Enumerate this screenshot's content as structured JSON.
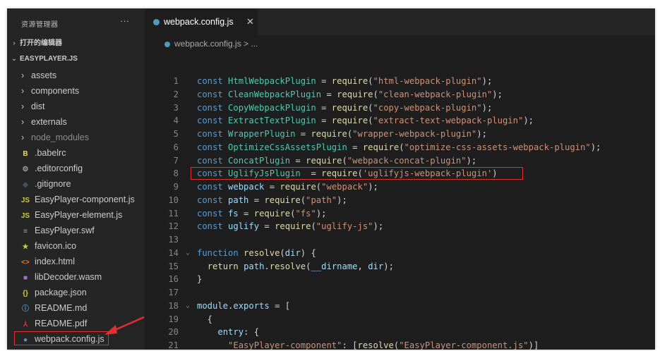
{
  "sidebar": {
    "explorer_title": "资源管理器",
    "more": "···",
    "open_editors": "打开的编辑器",
    "project": "EASYPLAYER.JS",
    "items": [
      {
        "label": "assets",
        "type": "folder",
        "icon": "chevron-right"
      },
      {
        "label": "components",
        "type": "folder",
        "icon": "chevron-right"
      },
      {
        "label": "dist",
        "type": "folder",
        "icon": "chevron-right"
      },
      {
        "label": "externals",
        "type": "folder",
        "icon": "chevron-right"
      },
      {
        "label": "node_modules",
        "type": "folder",
        "icon": "chevron-right"
      },
      {
        "label": ".babelrc",
        "type": "file",
        "icon": "babel-icon",
        "glyph": "B",
        "color": "#f5da55"
      },
      {
        "label": ".editorconfig",
        "type": "file",
        "icon": "gear-icon",
        "glyph": "⚙",
        "color": "#a0a0a0"
      },
      {
        "label": ".gitignore",
        "type": "file",
        "icon": "git-icon",
        "glyph": "◆",
        "color": "#41535b"
      },
      {
        "label": "EasyPlayer-component.js",
        "type": "file",
        "icon": "js-icon",
        "glyph": "JS",
        "color": "#cbcb41"
      },
      {
        "label": "EasyPlayer-element.js",
        "type": "file",
        "icon": "js-icon",
        "glyph": "JS",
        "color": "#cbcb41"
      },
      {
        "label": "EasyPlayer.swf",
        "type": "file",
        "icon": "file-icon",
        "glyph": "≡",
        "color": "#a0a0a0"
      },
      {
        "label": "favicon.ico",
        "type": "file",
        "icon": "star-icon",
        "glyph": "★",
        "color": "#cbcb41"
      },
      {
        "label": "index.html",
        "type": "file",
        "icon": "html-icon",
        "glyph": "<>",
        "color": "#e37933"
      },
      {
        "label": "libDecoder.wasm",
        "type": "file",
        "icon": "wasm-icon",
        "glyph": "■",
        "color": "#a074c4"
      },
      {
        "label": "package.json",
        "type": "file",
        "icon": "json-icon",
        "glyph": "{}",
        "color": "#cbcb41"
      },
      {
        "label": "README.md",
        "type": "file",
        "icon": "info-icon",
        "glyph": "ⓘ",
        "color": "#519aba"
      },
      {
        "label": "README.pdf",
        "type": "file",
        "icon": "pdf-icon",
        "glyph": "⅄",
        "color": "#cc3e44"
      },
      {
        "label": "webpack.config.js",
        "type": "file",
        "icon": "webpack-icon",
        "glyph": "●",
        "color": "#519aba"
      }
    ]
  },
  "editor": {
    "tab_label": "webpack.config.js",
    "tab_close": "✕",
    "breadcrumb": "webpack.config.js > ...",
    "lines": [
      {
        "n": "1",
        "code": "const HtmlWebpackPlugin = require(\"html-webpack-plugin\");"
      },
      {
        "n": "2",
        "code": "const CleanWebpackPlugin = require(\"clean-webpack-plugin\");"
      },
      {
        "n": "3",
        "code": "const CopyWebpackPlugin = require(\"copy-webpack-plugin\");"
      },
      {
        "n": "4",
        "code": "const ExtractTextPlugin = require(\"extract-text-webpack-plugin\");"
      },
      {
        "n": "5",
        "code": "const WrapperPlugin = require(\"wrapper-webpack-plugin\");"
      },
      {
        "n": "6",
        "code": "const OptimizeCssAssetsPlugin = require(\"optimize-css-assets-webpack-plugin\");"
      },
      {
        "n": "7",
        "code": "const ConcatPlugin = require(\"webpack-concat-plugin\");"
      },
      {
        "n": "8",
        "code": "const UglifyJsPlugin  = require('uglifyjs-webpack-plugin')"
      },
      {
        "n": "9",
        "code": "const webpack = require(\"webpack\");"
      },
      {
        "n": "10",
        "code": "const path = require(\"path\");"
      },
      {
        "n": "11",
        "code": "const fs = require(\"fs\");"
      },
      {
        "n": "12",
        "code": "const uglify = require(\"uglify-js\");"
      },
      {
        "n": "13",
        "code": ""
      },
      {
        "n": "14",
        "code": "function resolve(dir) {"
      },
      {
        "n": "15",
        "code": "  return path.resolve(__dirname, dir);"
      },
      {
        "n": "16",
        "code": "}"
      },
      {
        "n": "17",
        "code": ""
      },
      {
        "n": "18",
        "code": "module.exports = ["
      },
      {
        "n": "19",
        "code": "  {"
      },
      {
        "n": "20",
        "code": "    entry: {"
      },
      {
        "n": "21",
        "code": "      \"EasyPlayer-component\": [resolve(\"EasyPlayer-component.js\")]"
      }
    ]
  },
  "colors": {
    "highlight_box": "#e03030",
    "arrow": "#e03030"
  }
}
